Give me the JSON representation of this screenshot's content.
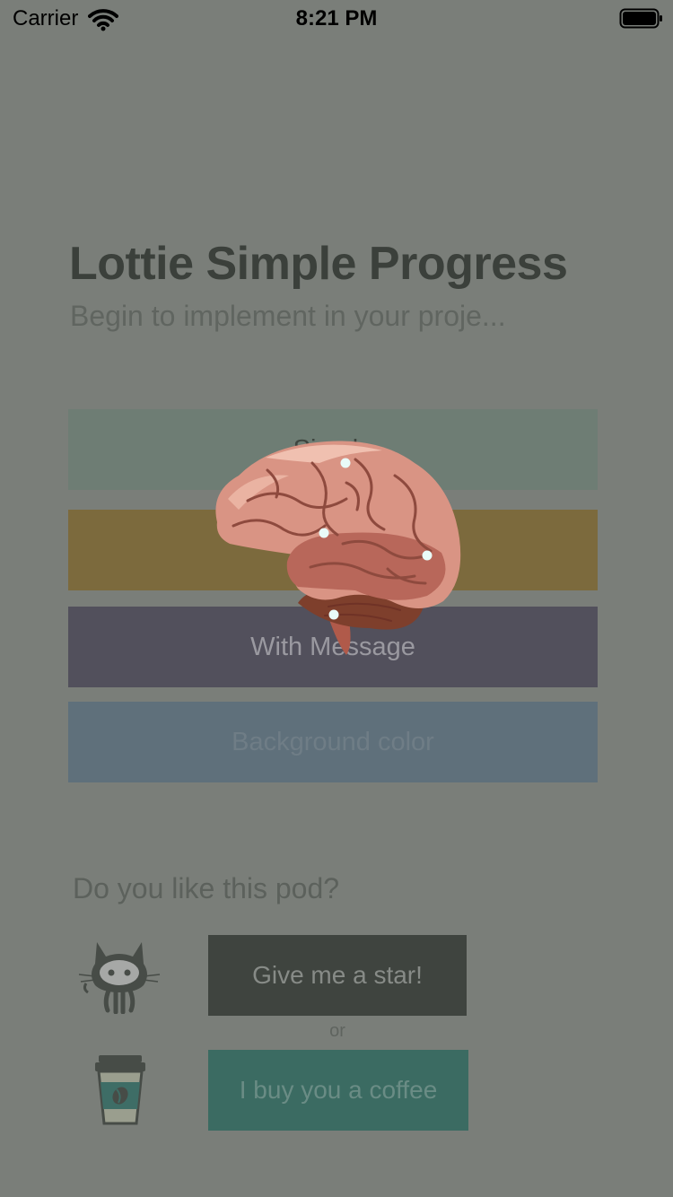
{
  "status_bar": {
    "carrier": "Carrier",
    "time": "8:21 PM"
  },
  "header": {
    "title": "Lottie Simple Progress",
    "subtitle": "Begin to implement in your proje..."
  },
  "options": {
    "simple": "Simple",
    "custom": "",
    "message": "With Message",
    "background": "Background color"
  },
  "loader": {
    "icon": "brain-animation"
  },
  "support": {
    "question": "Do you like this pod?",
    "star_label": "Give me a star!",
    "or_label": "or",
    "coffee_label": "I buy you a coffee"
  },
  "colors": {
    "background": "#7a7e79",
    "simple": "#6e7d74",
    "custom": "#7c6a3d",
    "message": "#52505c",
    "background_option": "#5f707b",
    "star_button": "#3f443f",
    "coffee_button": "#3b6b62"
  }
}
